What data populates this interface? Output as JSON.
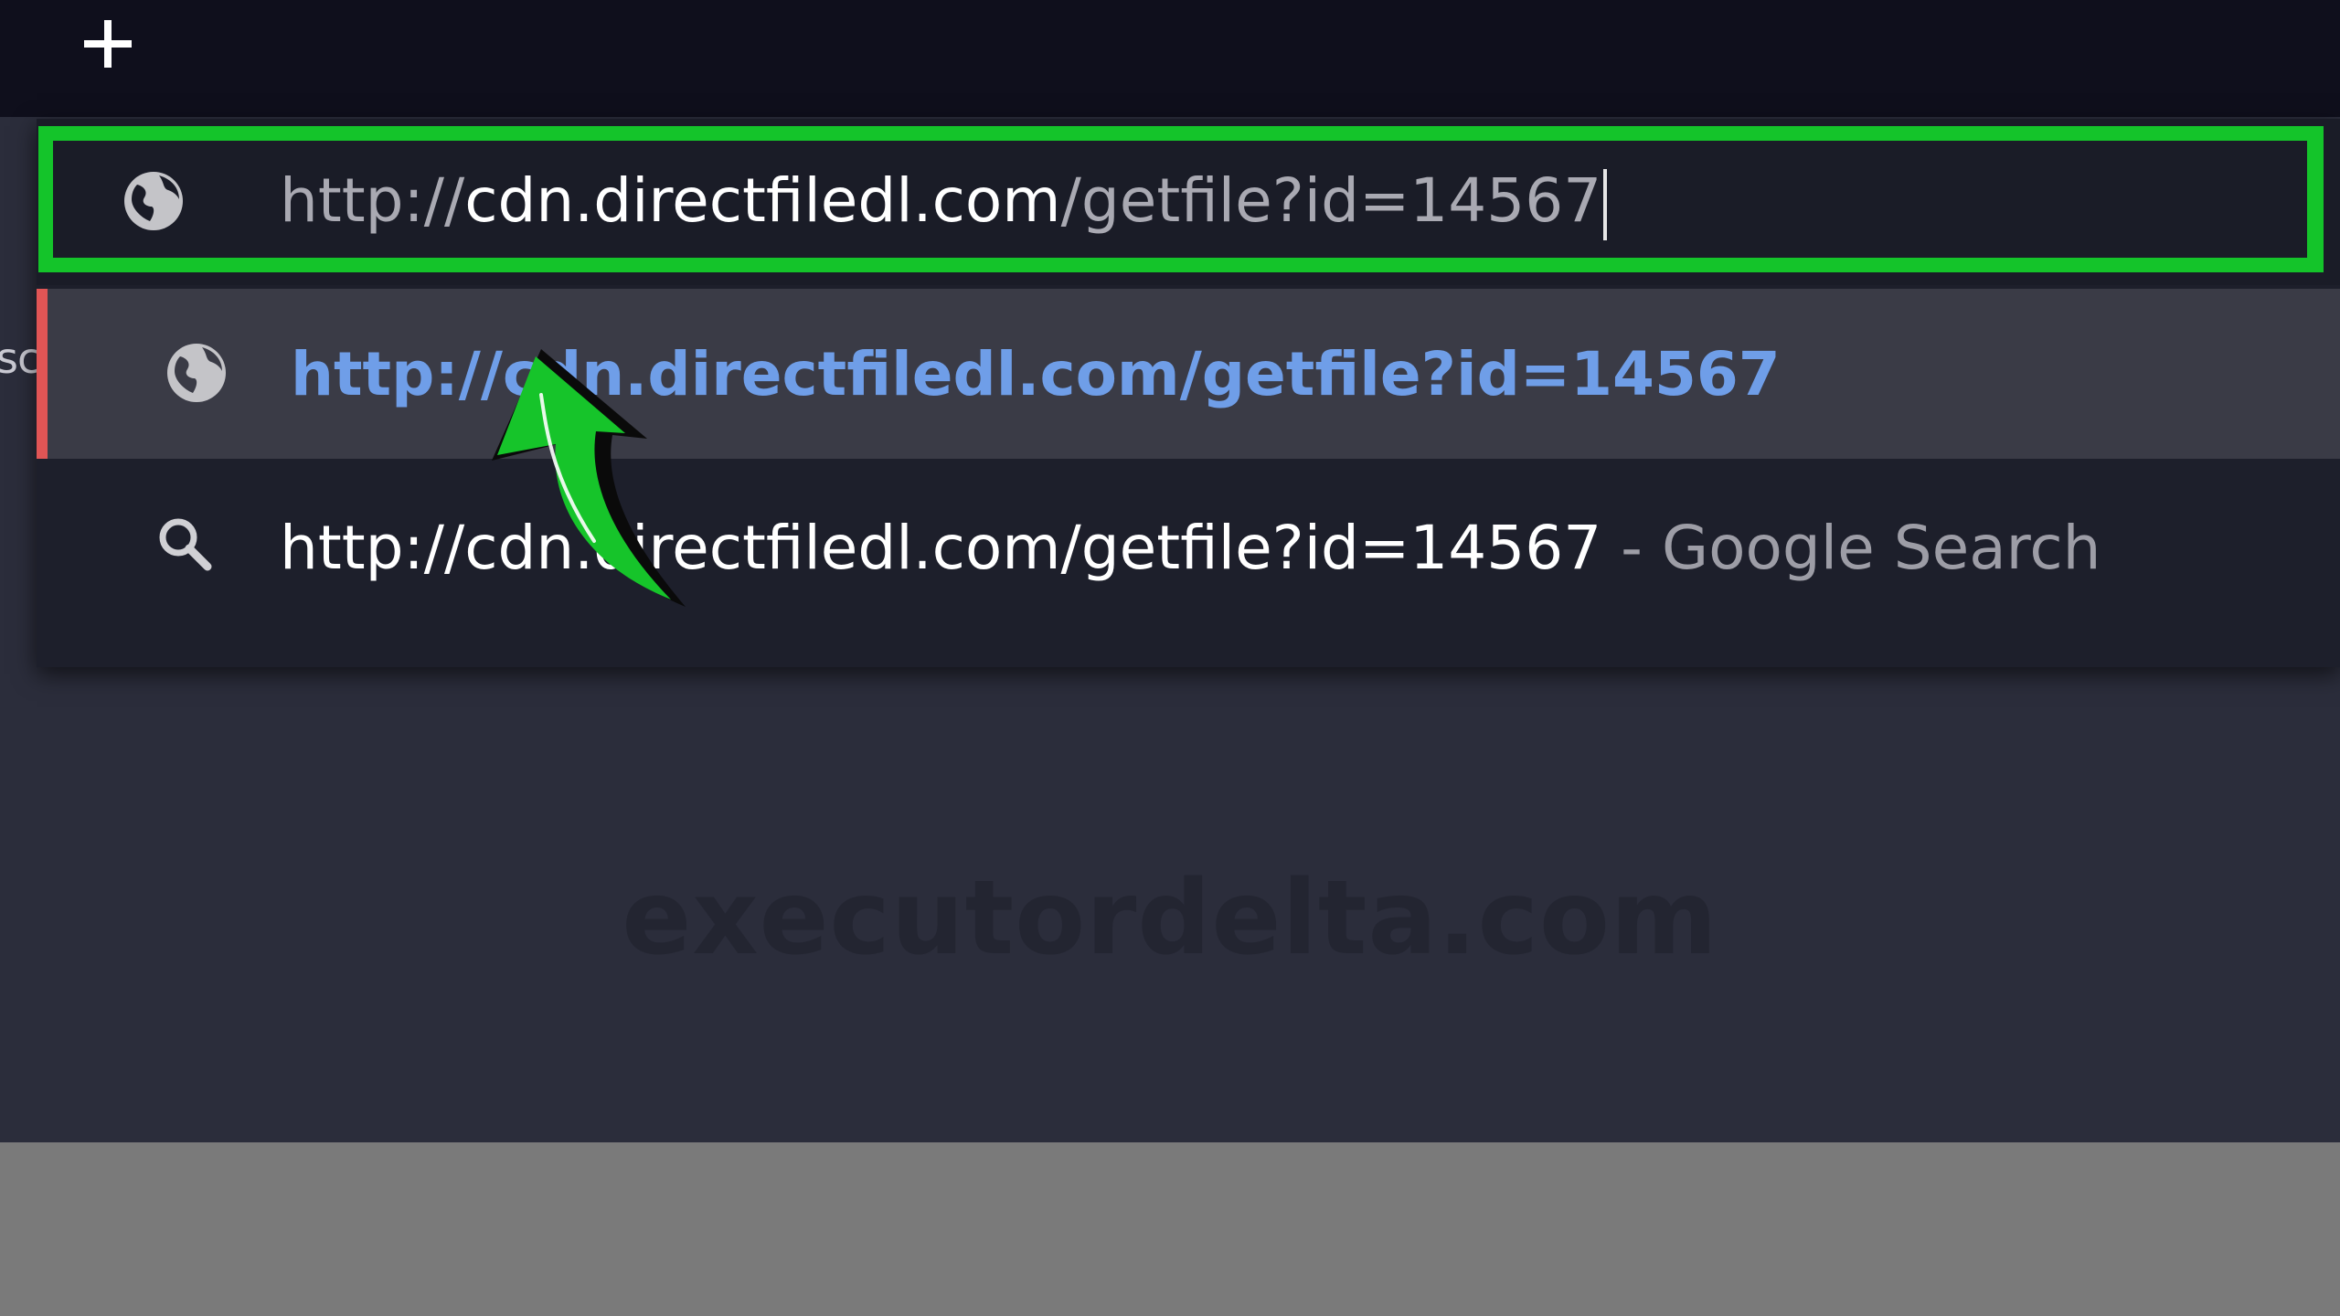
{
  "address_bar": {
    "prefix": "http://",
    "domain": "cdn.directfiledl.com",
    "path": "/getfile?id=14567",
    "icon": "globe-icon"
  },
  "suggestions": [
    {
      "text": "http://cdn.directfiledl.com/getfile?id=14567",
      "icon": "globe-icon",
      "selected": true
    },
    {
      "text": "http://cdn.directfiledl.com/getfile?id=14567",
      "suffix": " - Google Search",
      "icon": "search-icon",
      "selected": false
    }
  ],
  "left_edge_text": "sc",
  "watermark": "executordelta.com",
  "colors": {
    "highlight_box": "#14c42a",
    "arrow_fill": "#16c42a",
    "selected_link": "#6f9ee8",
    "selected_marker": "#e05555"
  },
  "tab_strip": {
    "new_tab_icon": "plus-icon"
  }
}
